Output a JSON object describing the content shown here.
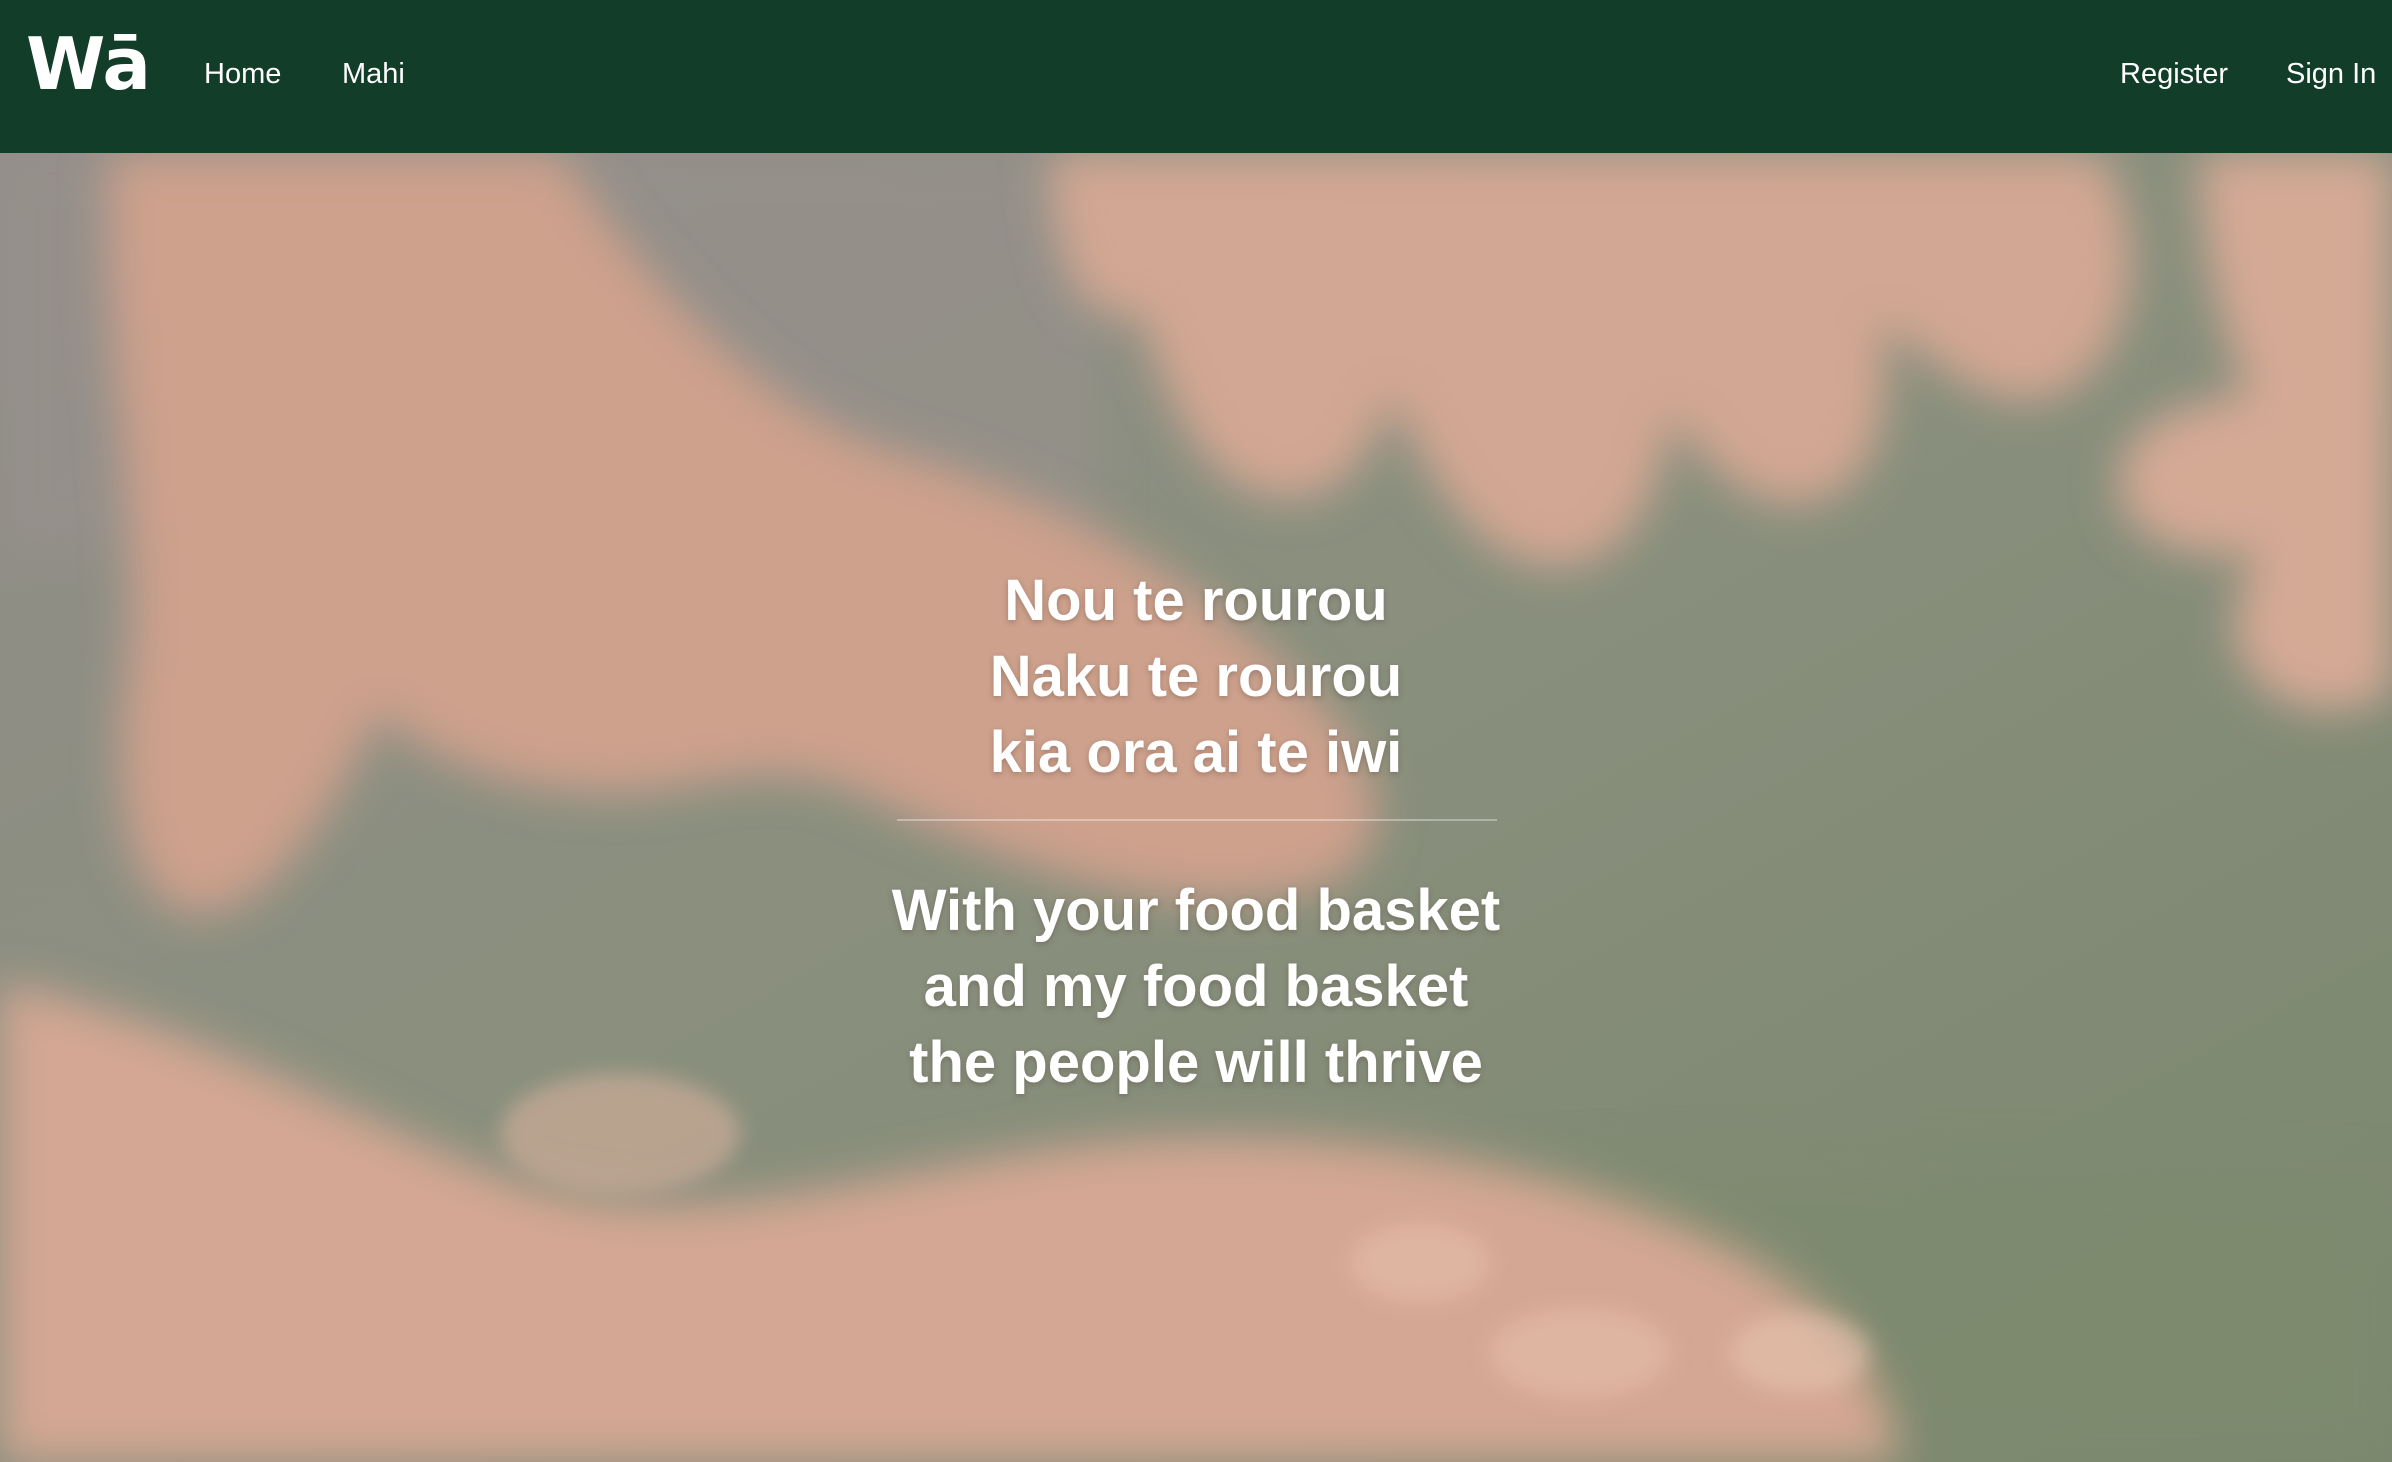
{
  "navbar": {
    "logo": "Wā",
    "left_links": [
      {
        "label": "Home"
      },
      {
        "label": "Mahi"
      }
    ],
    "right_links": [
      {
        "label": "Register"
      },
      {
        "label": "Sign In"
      }
    ],
    "background_color": "#123d29"
  },
  "hero": {
    "maori_lines": [
      "Nou te rourou",
      "Naku te rourou",
      "kia ora ai te iwi"
    ],
    "english_lines": [
      "With your food basket",
      "and my food basket",
      "the people will thrive"
    ],
    "text_color": "#ffffff"
  }
}
